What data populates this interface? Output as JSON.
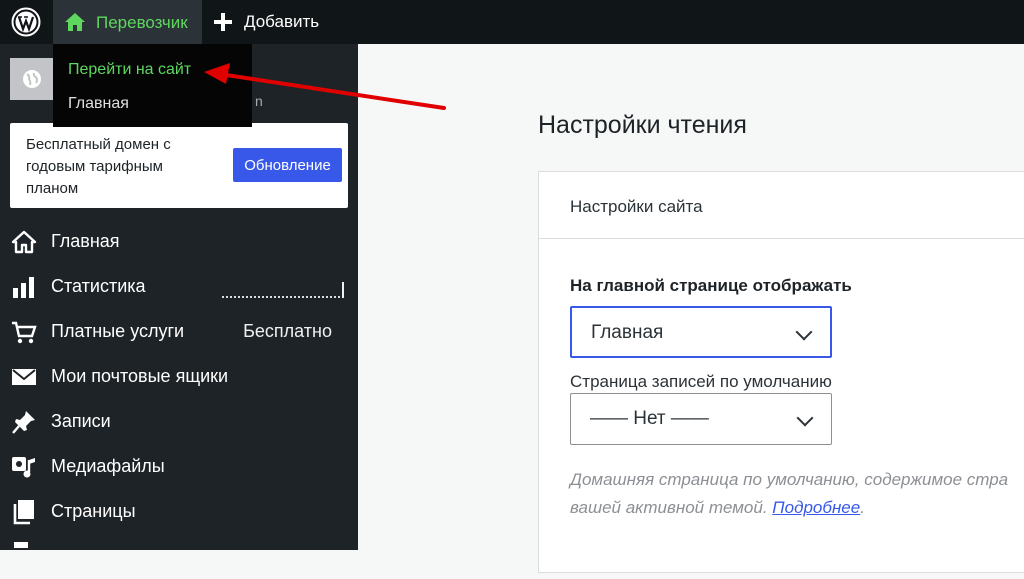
{
  "adminbar": {
    "logo_icon": "wordpress-logo-icon",
    "site_name": "Перевозчик",
    "add_new_label": "Добавить"
  },
  "dropdown": {
    "items": [
      "Перейти на сайт",
      "Главная"
    ]
  },
  "site_card": {
    "url_fragment": "n"
  },
  "upsell": {
    "text": "Бесплатный домен с годовым тарифным планом",
    "button": "Обновление"
  },
  "sidebar": {
    "items": [
      {
        "label": "Главная",
        "icon": "home-icon"
      },
      {
        "label": "Статистика",
        "icon": "stats-icon"
      },
      {
        "label": "Платные услуги",
        "icon": "cart-icon",
        "badge": "Бесплатно"
      },
      {
        "label": "Мои почтовые ящики",
        "icon": "mail-icon"
      },
      {
        "label": "Записи",
        "icon": "pin-icon"
      },
      {
        "label": "Медиафайлы",
        "icon": "media-icon"
      },
      {
        "label": "Страницы",
        "icon": "pages-icon"
      }
    ]
  },
  "main": {
    "title": "Настройки чтения",
    "panel_header": "Настройки сайта",
    "homepage_label": "На главной странице отображать",
    "homepage_value": "Главная",
    "posts_page_label": "Страница записей по умолчанию",
    "posts_page_value": "—— Нет ——",
    "help_line1": "Домашняя страница по умолчанию, содержимое стра",
    "help_line2_prefix": "вашей активной темой. ",
    "help_link": "Подробнее",
    "help_suffix": "."
  },
  "colors": {
    "adminbar_bg": "#101517",
    "sidebar_bg": "#1d2327",
    "accent_green": "#5ed75e",
    "primary_blue": "#3858e9",
    "annotation_red": "#e00000"
  }
}
